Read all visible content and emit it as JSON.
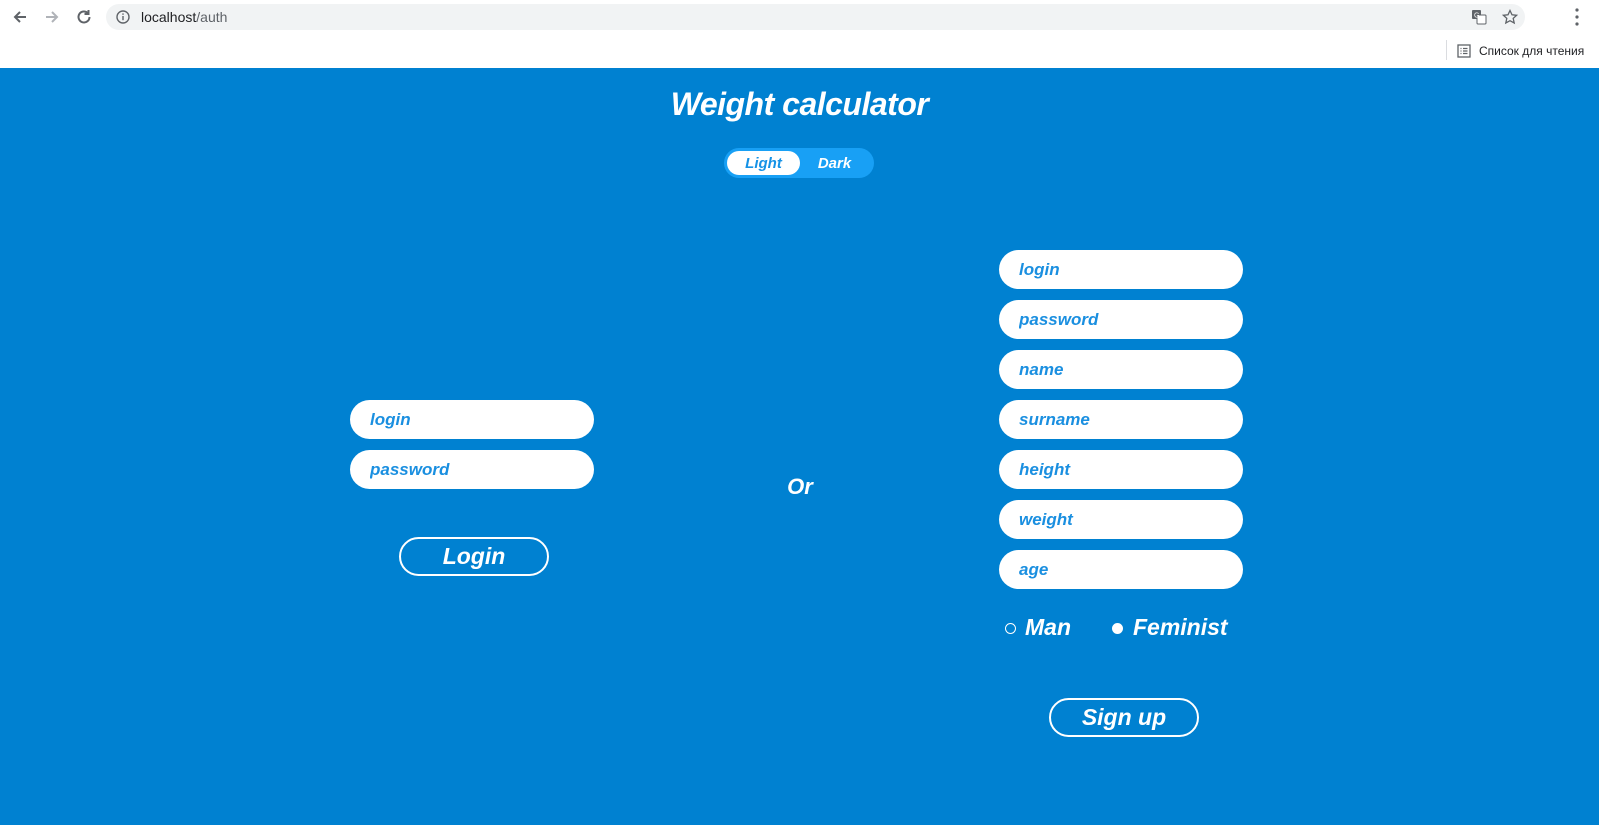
{
  "browser": {
    "url_host": "localhost",
    "url_path": "/auth",
    "reading_list_label": "Список для чтения"
  },
  "app": {
    "title": "Weight calculator",
    "theme_toggle": {
      "light_label": "Light",
      "dark_label": "Dark",
      "selected": "Light"
    },
    "login_form": {
      "login_placeholder": "login",
      "password_placeholder": "password",
      "submit_label": "Login"
    },
    "separator_label": "Or",
    "signup_form": {
      "login_placeholder": "login",
      "password_placeholder": "password",
      "name_placeholder": "name",
      "surname_placeholder": "surname",
      "height_placeholder": "height",
      "weight_placeholder": "weight",
      "age_placeholder": "age",
      "gender_options": [
        "Man",
        "Feminist"
      ],
      "submit_label": "Sign up"
    }
  },
  "colors": {
    "background": "#0081d1",
    "toggle_track": "#18a0f5",
    "input_text": "#1a8fe0",
    "white": "#ffffff"
  }
}
